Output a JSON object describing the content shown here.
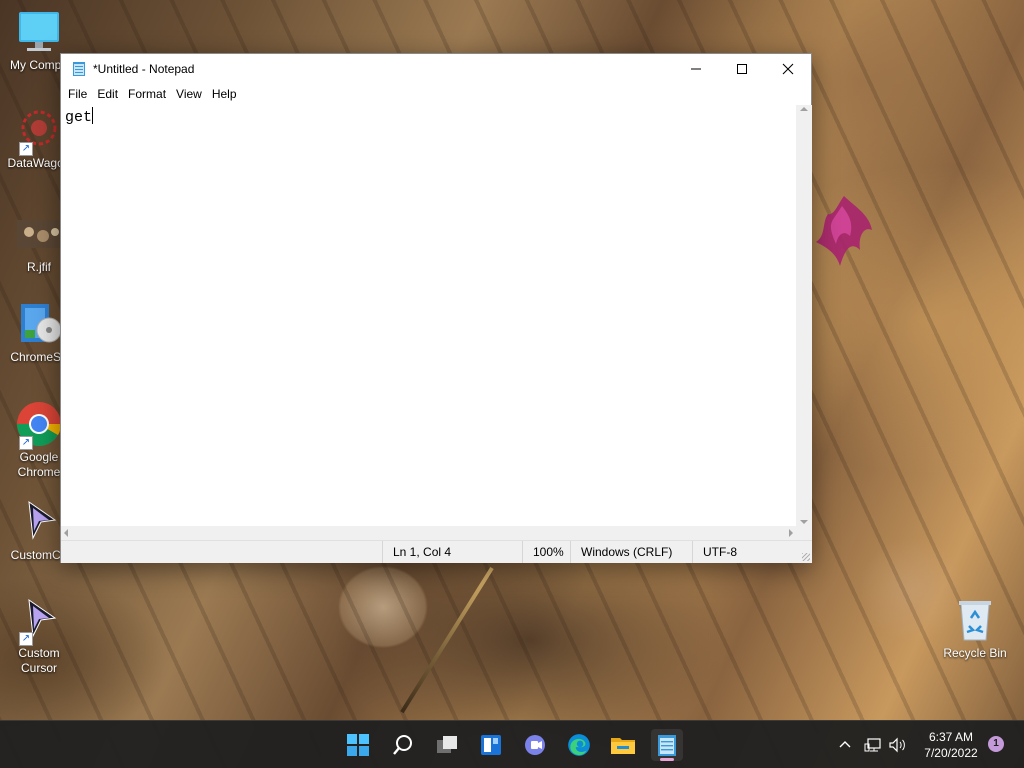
{
  "desktop": {
    "icons": [
      {
        "label": "My Compu",
        "icon": "computer-icon"
      },
      {
        "label": "DataWagon",
        "icon": "datawagon-icon"
      },
      {
        "label": "R.jfif",
        "icon": "image-file-icon"
      },
      {
        "label": "ChromeSe",
        "icon": "installer-icon"
      },
      {
        "label": "Google Chrome",
        "line1": "Google",
        "line2": "Chrome",
        "icon": "chrome-icon"
      },
      {
        "label": "CustomCu",
        "icon": "custom-cursor-icon"
      },
      {
        "label": "Custom Cursor",
        "line1": "Custom",
        "line2": "Cursor",
        "icon": "custom-cursor-icon"
      },
      {
        "label": "Recycle Bin",
        "icon": "recycle-bin-icon"
      }
    ]
  },
  "notepad": {
    "title": "*Untitled - Notepad",
    "menu": [
      "File",
      "Edit",
      "Format",
      "View",
      "Help"
    ],
    "content": "get",
    "status": {
      "position": "Ln 1, Col 4",
      "zoom": "100%",
      "line_ending": "Windows (CRLF)",
      "encoding": "UTF-8"
    }
  },
  "taskbar": {
    "apps": [
      "start-icon",
      "search-icon",
      "task-view-icon",
      "widgets-icon",
      "teams-chat-icon",
      "edge-icon",
      "file-explorer-icon",
      "notepad-icon"
    ],
    "active_app": "notepad-icon",
    "clock": {
      "time": "6:37 AM",
      "date": "7/20/2022"
    },
    "notification_count": "1"
  },
  "colors": {
    "taskbar_bg": "#202020",
    "window_bg": "#ffffff",
    "status_bg": "#f0f0f0"
  }
}
